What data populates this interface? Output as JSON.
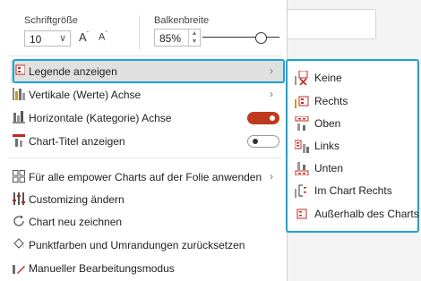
{
  "font_size": {
    "label": "Schriftgröße",
    "value": "10",
    "grow_label": "A",
    "shrink_label": "A"
  },
  "bar_width": {
    "label": "Balkenbreite",
    "value": "85%",
    "slider_fraction": 0.68
  },
  "menu": {
    "show_legend": "Legende anzeigen",
    "vertical_axis": "Vertikale (Werte) Achse",
    "horizontal_axis": "Horizontale (Kategorie) Achse",
    "horizontal_axis_on": true,
    "show_chart_title": "Chart-Titel anzeigen",
    "show_chart_title_on": false,
    "apply_all": "Für alle empower Charts auf der Folie anwenden",
    "customizing": "Customizing ändern",
    "redraw": "Chart neu zeichnen",
    "reset_colors": "Punktfarben und Umrandungen zurücksetzen",
    "manual_edit": "Manueller Bearbeitungsmodus"
  },
  "legend_submenu": {
    "items": [
      "Keine",
      "Rechts",
      "Oben",
      "Links",
      "Unten",
      "Im Chart Rechts",
      "Außerhalb des Charts"
    ]
  },
  "colors": {
    "accent_toggle": "#c0391e",
    "highlight_border": "#1aa3d4",
    "highlight_bg": "#e0e0e0"
  }
}
